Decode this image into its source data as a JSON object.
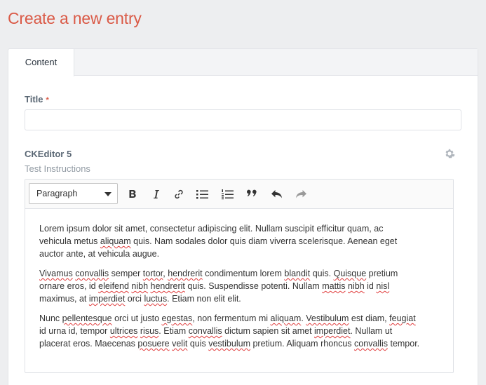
{
  "page": {
    "title": "Create a new entry"
  },
  "tabs": [
    {
      "label": "Content"
    }
  ],
  "fields": {
    "title": {
      "label": "Title",
      "required_mark": "*",
      "value": "",
      "placeholder": ""
    },
    "ckeditor": {
      "label": "CKEditor 5",
      "instructions": "Test Instructions"
    }
  },
  "toolbar": {
    "heading": "Paragraph",
    "buttons": [
      "bold-icon",
      "italic-icon",
      "link-icon",
      "bulleted-list-icon",
      "numbered-list-icon",
      "blockquote-icon",
      "undo-icon",
      "redo-icon"
    ]
  },
  "editor_content": {
    "paragraphs": [
      {
        "lines": [
          "Lorem ipsum dolor sit amet, consectetur adipiscing elit. Nullam suscipit efficitur quam, ac",
          "vehicula metus aliquam quis. Nam sodales dolor quis diam viverra scelerisque. Aenean eget",
          "auctor ante, at vehicula augue."
        ]
      },
      {
        "lines": [
          "Vivamus convallis semper tortor, hendrerit condimentum lorem blandit quis. Quisque pretium",
          "ornare eros, id eleifend nibh hendrerit quis. Suspendisse potenti. Nullam mattis nibh id nisl",
          "maximus, at imperdiet orci luctus. Etiam non elit elit."
        ]
      },
      {
        "lines": [
          "Nunc pellentesque orci ut justo egestas, non fermentum mi aliquam. Vestibulum est diam, feugiat",
          "id urna id, tempor ultrices risus. Etiam convallis dictum sapien sit amet imperdiet. Nullam ut",
          "placerat eros. Maecenas posuere velit quis vestibulum pretium. Aliquam rhoncus convallis tempor."
        ]
      }
    ],
    "misspelled": [
      "Vivamus",
      "convallis",
      "tortor",
      "hendrerit",
      "blandit",
      "Quisque",
      "eleifend",
      "nibh",
      "mattis",
      "nisl",
      "imperdiet",
      "luctus",
      "pellentesque",
      "egestas",
      "aliquam",
      "Vestibulum",
      "feugiat",
      "ultrices",
      "risus",
      "posuere",
      "velit",
      "vestibulum"
    ]
  },
  "colors": {
    "accent": "#da5a47",
    "background": "#edeef0",
    "spellcheck": "#e03b3b"
  }
}
